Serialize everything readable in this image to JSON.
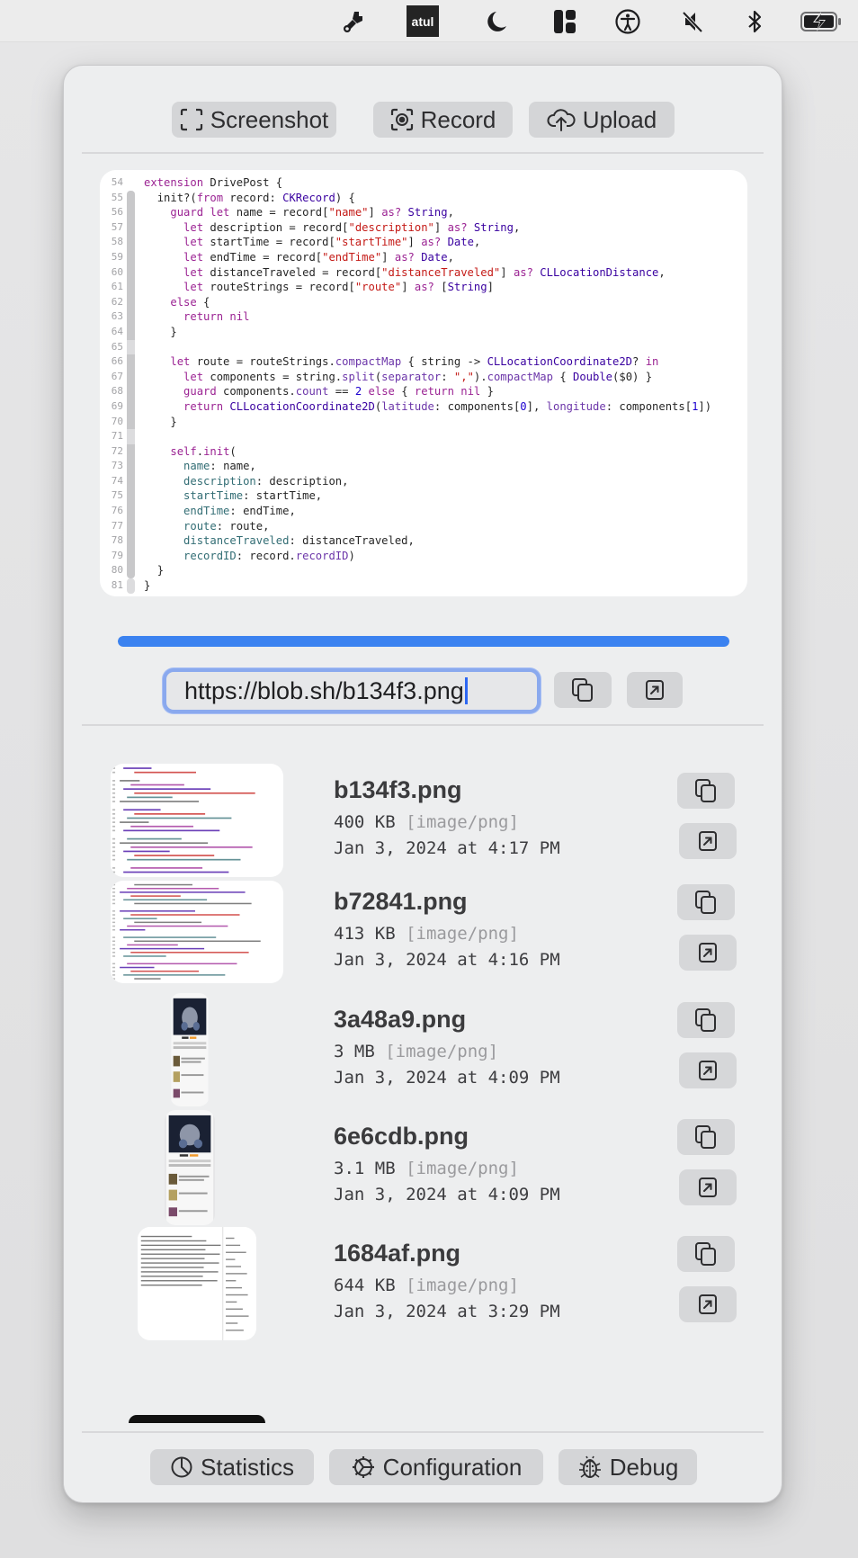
{
  "menubar": {
    "icons": [
      "paintbrush-icon",
      "atul-app-icon",
      "moon-icon",
      "layout-icon",
      "accessibility-icon",
      "speaker-muted-icon",
      "bluetooth-icon",
      "battery-charging-icon"
    ],
    "app_label": "atul"
  },
  "toolbar": {
    "screenshot_label": "Screenshot",
    "record_label": "Record",
    "upload_label": "Upload"
  },
  "preview": {
    "code_lines": [
      {
        "n": "54",
        "html": "<span class='kw'>extension</span> <span class='tx'>DrivePost {</span>"
      },
      {
        "n": "55",
        "html": "  <span class='tx'>init?(</span><span class='kw'>from</span><span class='tx'> record: </span><span class='ty'>CKRecord</span><span class='tx'>) {</span>"
      },
      {
        "n": "56",
        "html": "    <span class='kw'>guard let</span><span class='tx'> name = record[</span><span class='st'>\"name\"</span><span class='tx'>] </span><span class='kw'>as?</span><span class='tx'> </span><span class='ty'>String</span><span class='tx'>,</span>"
      },
      {
        "n": "57",
        "html": "      <span class='kw'>let</span><span class='tx'> description = record[</span><span class='st'>\"description\"</span><span class='tx'>] </span><span class='kw'>as?</span><span class='tx'> </span><span class='ty'>String</span><span class='tx'>,</span>"
      },
      {
        "n": "58",
        "html": "      <span class='kw'>let</span><span class='tx'> startTime = record[</span><span class='st'>\"startTime\"</span><span class='tx'>] </span><span class='kw'>as?</span><span class='tx'> </span><span class='ty'>Date</span><span class='tx'>,</span>"
      },
      {
        "n": "59",
        "html": "      <span class='kw'>let</span><span class='tx'> endTime = record[</span><span class='st'>\"endTime\"</span><span class='tx'>] </span><span class='kw'>as?</span><span class='tx'> </span><span class='ty'>Date</span><span class='tx'>,</span>"
      },
      {
        "n": "60",
        "html": "      <span class='kw'>let</span><span class='tx'> distanceTraveled = record[</span><span class='st'>\"distanceTraveled\"</span><span class='tx'>] </span><span class='kw'>as?</span><span class='tx'> </span><span class='ty'>CLLocationDistance</span><span class='tx'>,</span>"
      },
      {
        "n": "61",
        "html": "      <span class='kw'>let</span><span class='tx'> routeStrings = record[</span><span class='st'>\"route\"</span><span class='tx'>] </span><span class='kw'>as?</span><span class='tx'> [</span><span class='ty'>String</span><span class='tx'>]</span>"
      },
      {
        "n": "62",
        "html": "    <span class='kw'>else</span><span class='tx'> {</span>"
      },
      {
        "n": "63",
        "html": "      <span class='kw'>return nil</span>"
      },
      {
        "n": "64",
        "html": "    <span class='tx'>}</span>"
      },
      {
        "n": "65",
        "html": ""
      },
      {
        "n": "66",
        "html": "    <span class='kw'>let</span><span class='tx'> route = routeStrings.</span><span class='mt'>compactMap</span><span class='tx'> { string -&gt; </span><span class='ty'>CLLocationCoordinate2D</span><span class='tx'>? </span><span class='kw'>in</span>"
      },
      {
        "n": "67",
        "html": "      <span class='kw'>let</span><span class='tx'> components = string.</span><span class='mt'>split</span><span class='tx'>(</span><span class='mt'>separator</span><span class='tx'>: </span><span class='st'>\",\"</span><span class='tx'>).</span><span class='mt'>compactMap</span><span class='tx'> { </span><span class='ty'>Double</span><span class='tx'>($0) }</span>"
      },
      {
        "n": "68",
        "html": "      <span class='kw'>guard</span><span class='tx'> components.</span><span class='mt'>count</span><span class='tx'> == </span><span class='nm'>2</span><span class='tx'> </span><span class='kw'>else</span><span class='tx'> { </span><span class='kw'>return nil</span><span class='tx'> }</span>"
      },
      {
        "n": "69",
        "html": "      <span class='kw'>return</span><span class='tx'> </span><span class='ty'>CLLocationCoordinate2D</span><span class='tx'>(</span><span class='mt'>latitude</span><span class='tx'>: components[</span><span class='nm'>0</span><span class='tx'>], </span><span class='mt'>longitude</span><span class='tx'>: components[</span><span class='nm'>1</span><span class='tx'>])</span>"
      },
      {
        "n": "70",
        "html": "    <span class='tx'>}</span>"
      },
      {
        "n": "71",
        "html": ""
      },
      {
        "n": "72",
        "html": "    <span class='kw'>self</span><span class='tx'>.</span><span class='kw'>init</span><span class='tx'>(</span>"
      },
      {
        "n": "73",
        "html": "      <span class='pr'>name</span><span class='tx'>: name,</span>"
      },
      {
        "n": "74",
        "html": "      <span class='pr'>description</span><span class='tx'>: description,</span>"
      },
      {
        "n": "75",
        "html": "      <span class='pr'>startTime</span><span class='tx'>: startTime,</span>"
      },
      {
        "n": "76",
        "html": "      <span class='pr'>endTime</span><span class='tx'>: endTime,</span>"
      },
      {
        "n": "77",
        "html": "      <span class='pr'>route</span><span class='tx'>: route,</span>"
      },
      {
        "n": "78",
        "html": "      <span class='pr'>distanceTraveled</span><span class='tx'>: distanceTraveled,</span>"
      },
      {
        "n": "79",
        "html": "      <span class='pr'>recordID</span><span class='tx'>: record.</span><span class='mt'>recordID</span><span class='tx'>)</span>"
      },
      {
        "n": "80",
        "html": "  <span class='tx'>}</span>"
      },
      {
        "n": "81",
        "html": "<span class='tx'>}</span>"
      }
    ]
  },
  "upload": {
    "progress_percent": 100,
    "url_value": "https://blob.sh/b134f3.png",
    "copy_icon": "copy-icon",
    "open_icon": "open-external-icon"
  },
  "files": [
    {
      "name": "b134f3.png",
      "size": "400 KB",
      "mime": "[image/png]",
      "date": "Jan 3, 2024 at 4:17 PM",
      "thumb": "code"
    },
    {
      "name": "b72841.png",
      "size": "413 KB",
      "mime": "[image/png]",
      "date": "Jan 3, 2024 at 4:16 PM",
      "thumb": "code"
    },
    {
      "name": "3a48a9.png",
      "size": "3 MB",
      "mime": "[image/png]",
      "date": "Jan 3, 2024 at 4:09 PM",
      "thumb": "phone"
    },
    {
      "name": "6e6cdb.png",
      "size": "3.1 MB",
      "mime": "[image/png]",
      "date": "Jan 3, 2024 at 4:09 PM",
      "thumb": "phone"
    },
    {
      "name": "1684af.png",
      "size": "644 KB",
      "mime": "[image/png]",
      "date": "Jan 3, 2024 at 3:29 PM",
      "thumb": "doc"
    }
  ],
  "footer": {
    "statistics_label": "Statistics",
    "configuration_label": "Configuration",
    "debug_label": "Debug"
  }
}
